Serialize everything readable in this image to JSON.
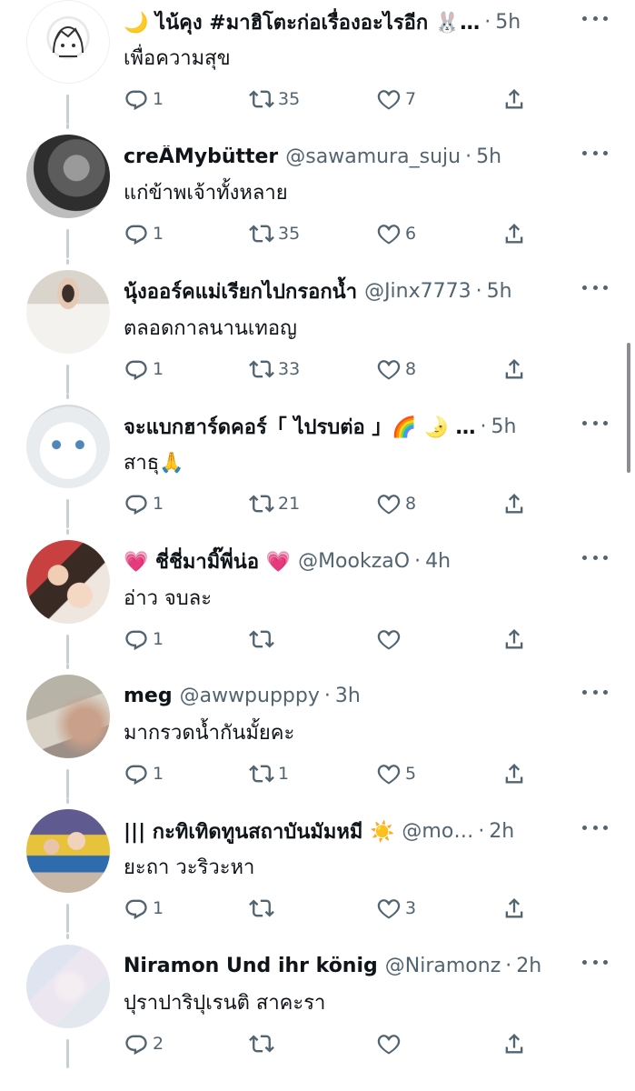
{
  "colors": {
    "text_primary": "#0f1419",
    "text_secondary": "#536471",
    "thread_line": "#c4cfd6"
  },
  "tweets": [
    {
      "name": "🌙 ไน้คุง #มาฮิโตะก่อเรื่องอะไรอีก 🐰…",
      "handle": "",
      "time": "5h",
      "text": "เพื่อความสุข",
      "replies": "1",
      "retweets": "35",
      "likes": "7",
      "avatar_icon": "drawn-character-avatar"
    },
    {
      "name": "creÄMybütter",
      "handle": "@sawamura_suju",
      "time": "5h",
      "text": "แก่ข้าพเจ้าทั้งหลาย",
      "replies": "1",
      "retweets": "35",
      "likes": "6",
      "avatar_icon": "grayscale-cat-avatar"
    },
    {
      "name": "นุ้งออร์คแม่เรียกไปกรอกน้ำ",
      "handle": "@Jinx7773",
      "time": "5h",
      "text": "ตลอดกาลนานเทอญ",
      "replies": "1",
      "retweets": "33",
      "likes": "8",
      "avatar_icon": "person-white-shirt-avatar"
    },
    {
      "name": "จะแบกฮาร์ดคอร์「 ไปรบต่อ 」🌈 🌛 …",
      "handle": "",
      "time": "5h",
      "text": "สาธุ🙏",
      "replies": "1",
      "retweets": "21",
      "likes": "8",
      "avatar_icon": "white-cat-avatar"
    },
    {
      "name": "💗 ชี่ชี่มามิ๊พี่น่อ 💗",
      "handle": "@MookzaO",
      "time": "4h",
      "text": "อ่าว จบละ",
      "replies": "1",
      "retweets": "",
      "likes": "",
      "avatar_icon": "two-people-avatar"
    },
    {
      "name": "meg",
      "handle": "@awwpupppy",
      "time": "3h",
      "text": "มากรวดน้ำกันมั้ยคะ",
      "replies": "1",
      "retweets": "1",
      "likes": "5",
      "avatar_icon": "blurry-photo-avatar"
    },
    {
      "name": "||| กะทิเทิดทูนสถาบันมัมหมี ☀️",
      "handle": "@mo…",
      "time": "2h",
      "text": "ยะถา วะริวะหา",
      "replies": "1",
      "retweets": "",
      "likes": "3",
      "avatar_icon": "children-group-avatar"
    },
    {
      "name": "Niramon Und ihr könig",
      "handle": "@Niramonz",
      "time": "2h",
      "text": "ปุราปาริปุเรนติ สาคะรา",
      "replies": "2",
      "retweets": "",
      "likes": "",
      "avatar_icon": "pastel-hand-avatar"
    }
  ]
}
